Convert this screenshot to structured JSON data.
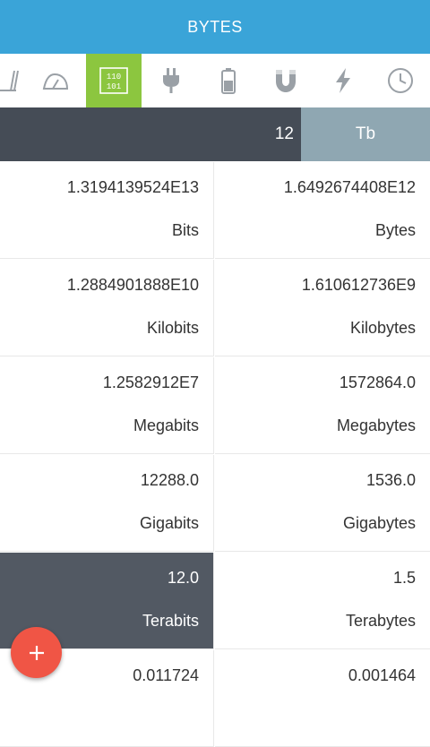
{
  "app": {
    "title": "BYTES"
  },
  "categories": [
    {
      "icon": "volume-icon",
      "active": false
    },
    {
      "icon": "speed-icon",
      "active": false
    },
    {
      "icon": "binary-data-icon",
      "active": true,
      "label_top": "110",
      "label_bottom": "101"
    },
    {
      "icon": "plug-icon",
      "active": false
    },
    {
      "icon": "battery-icon",
      "active": false
    },
    {
      "icon": "magnet-icon",
      "active": false
    },
    {
      "icon": "lightning-icon",
      "active": false
    },
    {
      "icon": "clock-icon",
      "active": false
    }
  ],
  "input": {
    "value": "12",
    "unit": "Tb"
  },
  "results": [
    {
      "value": "1.3194139524E13",
      "unit": "Bits",
      "selected": false
    },
    {
      "value": "1.6492674408E12",
      "unit": "Bytes",
      "selected": false
    },
    {
      "value": "1.2884901888E10",
      "unit": "Kilobits",
      "selected": false
    },
    {
      "value": "1.610612736E9",
      "unit": "Kilobytes",
      "selected": false
    },
    {
      "value": "1.2582912E7",
      "unit": "Megabits",
      "selected": false
    },
    {
      "value": "1572864.0",
      "unit": "Megabytes",
      "selected": false
    },
    {
      "value": "12288.0",
      "unit": "Gigabits",
      "selected": false
    },
    {
      "value": "1536.0",
      "unit": "Gigabytes",
      "selected": false
    },
    {
      "value": "12.0",
      "unit": "Terabits",
      "selected": true
    },
    {
      "value": "1.5",
      "unit": "Terabytes",
      "selected": false
    },
    {
      "value": "0.011724",
      "unit": "",
      "selected": false
    },
    {
      "value": "0.001464",
      "unit": "",
      "selected": false
    }
  ],
  "fab": {
    "icon": "plus-icon"
  },
  "colors": {
    "appbar": "#3aa4d8",
    "active_tab": "#8cc63f",
    "input_bar": "#454c56",
    "unit_button": "#8fa7b2",
    "fab": "#f05545"
  }
}
